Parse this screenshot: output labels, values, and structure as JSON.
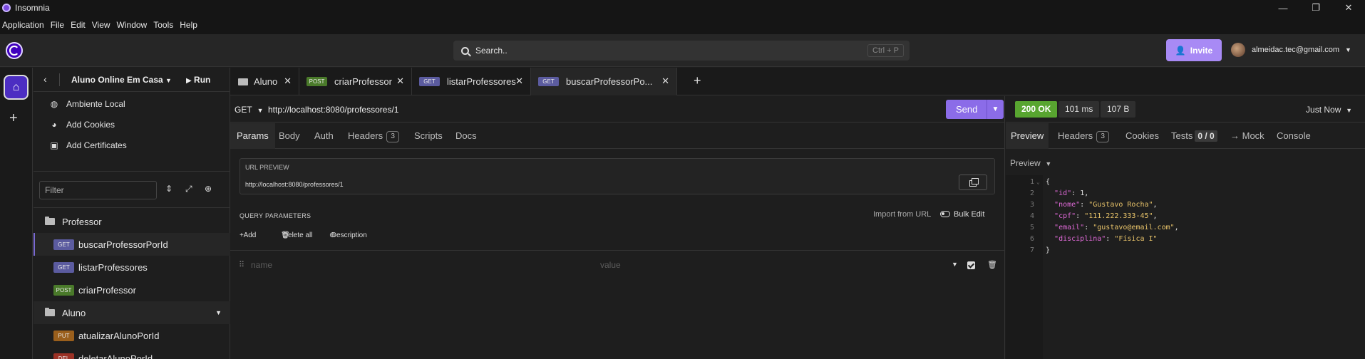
{
  "window": {
    "title": "Insomnia",
    "controls": [
      "—",
      "❐",
      "✕"
    ]
  },
  "menu": [
    "Application",
    "File",
    "Edit",
    "View",
    "Window",
    "Tools",
    "Help"
  ],
  "header": {
    "search_placeholder": "Search..",
    "search_shortcut": "Ctrl + P",
    "invite_label": "Invite",
    "account_email": "almeidac.tec@gmail.com"
  },
  "sidebar": {
    "project": "Aluno Online Em Casa",
    "run_label": "Run",
    "top_items": [
      {
        "label": "Ambiente Local",
        "icon": "globe-icon"
      },
      {
        "label": "Add Cookies",
        "icon": "cookie-icon"
      },
      {
        "label": "Add Certificates",
        "icon": "certificate-icon"
      }
    ],
    "filter_placeholder": "Filter",
    "folders": [
      {
        "name": "Professor",
        "requests": [
          {
            "method": "GET",
            "name": "buscarProfessorPorId",
            "active": true
          },
          {
            "method": "GET",
            "name": "listarProfessores"
          },
          {
            "method": "POST",
            "name": "criarProfessor"
          }
        ]
      },
      {
        "name": "Aluno",
        "requests": [
          {
            "method": "PUT",
            "name": "atualizarAlunoPorId"
          },
          {
            "method": "DEL",
            "name": "deletarAlunoPorId"
          }
        ]
      }
    ]
  },
  "tabs": [
    {
      "type": "folder",
      "label": "Aluno"
    },
    {
      "method": "POST",
      "label": "criarProfessor"
    },
    {
      "method": "GET",
      "label": "listarProfessores"
    },
    {
      "method": "GET",
      "label": "buscarProfessorPo...",
      "active": true
    }
  ],
  "request": {
    "method": "GET",
    "url": "http://localhost:8080/professores/1",
    "send_label": "Send",
    "subtabs": {
      "params": "Params",
      "body": "Body",
      "auth": "Auth",
      "headers": "Headers",
      "headers_count": "3",
      "scripts": "Scripts",
      "docs": "Docs"
    },
    "url_preview_caption": "URL PREVIEW",
    "url_preview_value": "http://localhost:8080/professores/1",
    "query_params_title": "QUERY PARAMETERS",
    "import_from_url": "Import from URL",
    "bulk_edit": "Bulk Edit",
    "add_label": "Add",
    "delete_all_label": "Delete all",
    "description_label": "Description",
    "param_name_placeholder": "name",
    "param_value_placeholder": "value"
  },
  "response": {
    "status": "200 OK",
    "time": "101 ms",
    "size": "107 B",
    "timestamp": "Just Now",
    "tabs": {
      "preview": "Preview",
      "headers": "Headers",
      "headers_count": "3",
      "cookies": "Cookies",
      "tests": "Tests",
      "tests_count": "0 / 0",
      "mock": "→ Mock",
      "console": "Console"
    },
    "preview_mode": "Preview",
    "body_lines": [
      {
        "n": "1",
        "fold": "⌄",
        "parts": [
          [
            "p",
            "{"
          ]
        ]
      },
      {
        "n": "2",
        "parts": [
          [
            "p",
            "  "
          ],
          [
            "k",
            "\"id\""
          ],
          [
            "p",
            ": "
          ],
          [
            "n",
            "1"
          ],
          [
            "p",
            ","
          ]
        ]
      },
      {
        "n": "3",
        "parts": [
          [
            "p",
            "  "
          ],
          [
            "k",
            "\"nome\""
          ],
          [
            "p",
            ": "
          ],
          [
            "s",
            "\"Gustavo Rocha\""
          ],
          [
            "p",
            ","
          ]
        ]
      },
      {
        "n": "4",
        "parts": [
          [
            "p",
            "  "
          ],
          [
            "k",
            "\"cpf\""
          ],
          [
            "p",
            ": "
          ],
          [
            "s",
            "\"111.222.333-45\""
          ],
          [
            "p",
            ","
          ]
        ]
      },
      {
        "n": "5",
        "parts": [
          [
            "p",
            "  "
          ],
          [
            "k",
            "\"email\""
          ],
          [
            "p",
            ": "
          ],
          [
            "s",
            "\"gustavo@email.com\""
          ],
          [
            "p",
            ","
          ]
        ]
      },
      {
        "n": "6",
        "parts": [
          [
            "p",
            "  "
          ],
          [
            "k",
            "\"disciplina\""
          ],
          [
            "p",
            ": "
          ],
          [
            "s",
            "\"Física I\""
          ]
        ]
      },
      {
        "n": "7",
        "parts": [
          [
            "p",
            "}"
          ]
        ]
      }
    ]
  },
  "colors": {
    "accent": "#8b6ce8",
    "ok": "#58a530",
    "get": "#5b5b9f",
    "post": "#4a7a2a",
    "put": "#9a5f1c",
    "del": "#9b3226"
  }
}
